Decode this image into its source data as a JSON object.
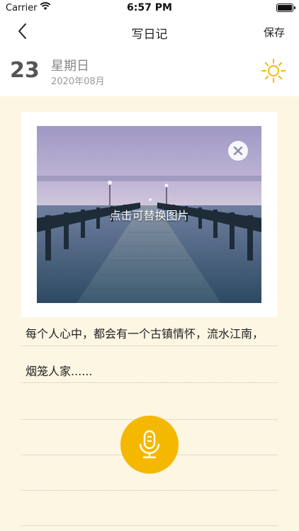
{
  "status": {
    "carrier": "Carrier",
    "time": "6:57 PM"
  },
  "nav": {
    "title": "写日记",
    "save_label": "保存"
  },
  "date": {
    "day": "23",
    "weekday": "星期日",
    "year_month": "2020年08月"
  },
  "photo": {
    "hint": "点击可替换图片"
  },
  "diary": {
    "line1": "每个人心中，都会有一个古镇情怀，流水江南，",
    "line2": "烟笼人家......"
  },
  "colors": {
    "accent": "#f5b800",
    "paper": "#fdf6e3",
    "sun": "#f5b800"
  }
}
